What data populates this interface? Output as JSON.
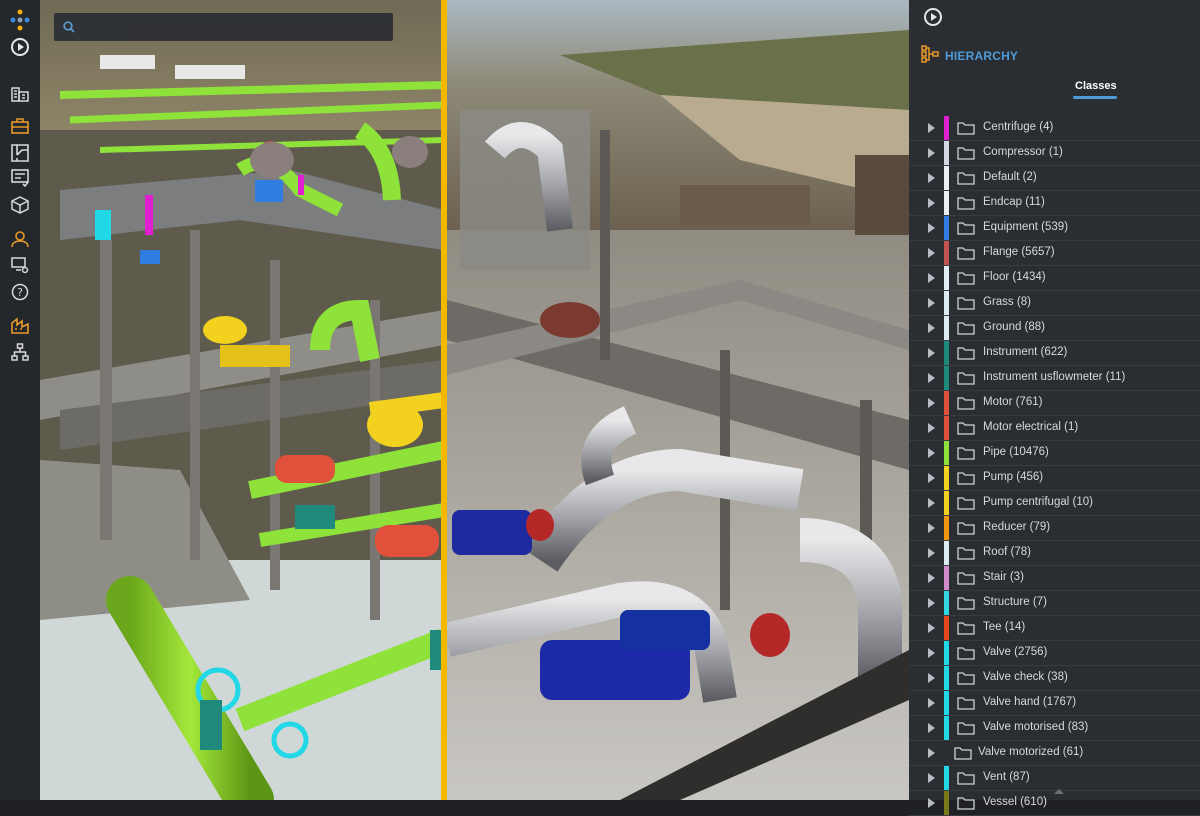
{
  "toolbar": {
    "items": [
      {
        "icon": "logo-icon"
      },
      {
        "icon": "play-icon"
      },
      {
        "icon": "buildings-icon"
      },
      {
        "icon": "briefcase-icon",
        "color": "#e89a2a"
      },
      {
        "icon": "floorplan-icon"
      },
      {
        "icon": "notes-icon"
      },
      {
        "icon": "cube-icon"
      },
      {
        "icon": "user-icon",
        "color": "#e89a2a"
      },
      {
        "icon": "screen-settings-icon"
      },
      {
        "icon": "help-icon"
      },
      {
        "icon": "site-icon",
        "color": "#e89a2a"
      },
      {
        "icon": "hierarchy-tree-icon"
      }
    ]
  },
  "search": {
    "placeholder": "",
    "value": "",
    "icon": "search-icon"
  },
  "viewport": {
    "divider_color": "#f5b800",
    "divider_fraction": 0.466
  },
  "panel": {
    "play_icon": "play-icon",
    "section_title": "HIERARCHY",
    "tab_label": "Classes",
    "accent": "#4d9bd8",
    "classes": [
      {
        "label": "Centrifuge (4)",
        "color": "#e020d0"
      },
      {
        "label": "Compressor (1)",
        "color": "#d6d6e4"
      },
      {
        "label": "Default (2)",
        "color": "#eceef2"
      },
      {
        "label": "Endcap (11)",
        "color": "#eceef2"
      },
      {
        "label": "Equipment (539)",
        "color": "#2f7de0"
      },
      {
        "label": "Flange (5657)",
        "color": "#c2524e"
      },
      {
        "label": "Floor (1434)",
        "color": "#e2eef4"
      },
      {
        "label": "Grass (8)",
        "color": "#dcecf2"
      },
      {
        "label": "Ground (88)",
        "color": "#dcecf2"
      },
      {
        "label": "Instrument (622)",
        "color": "#1f8a7c"
      },
      {
        "label": "Instrument usflowmeter (11)",
        "color": "#1f8a7c"
      },
      {
        "label": "Motor (761)",
        "color": "#e0503a"
      },
      {
        "label": "Motor electrical (1)",
        "color": "#e0503a"
      },
      {
        "label": "Pipe (10476)",
        "color": "#8fe23a"
      },
      {
        "label": "Pump (456)",
        "color": "#f2d21e"
      },
      {
        "label": "Pump centrifugal (10)",
        "color": "#f2d21e"
      },
      {
        "label": "Reducer (79)",
        "color": "#f2960a"
      },
      {
        "label": "Roof (78)",
        "color": "#dcecf2"
      },
      {
        "label": "Stair (3)",
        "color": "#d08acb"
      },
      {
        "label": "Structure (7)",
        "color": "#32d6e0"
      },
      {
        "label": "Tee (14)",
        "color": "#e8461e"
      },
      {
        "label": "Valve (2756)",
        "color": "#22d8e6"
      },
      {
        "label": "Valve check (38)",
        "color": "#22d8e6"
      },
      {
        "label": "Valve hand (1767)",
        "color": "#22d8e6"
      },
      {
        "label": "Valve motorised (83)",
        "color": "#22d8e6"
      },
      {
        "label": "Valve motorized (61)",
        "color": ""
      },
      {
        "label": "Vent (87)",
        "color": "#22d8e6"
      },
      {
        "label": "Vessel (610)",
        "color": "#7a7a18"
      }
    ]
  }
}
